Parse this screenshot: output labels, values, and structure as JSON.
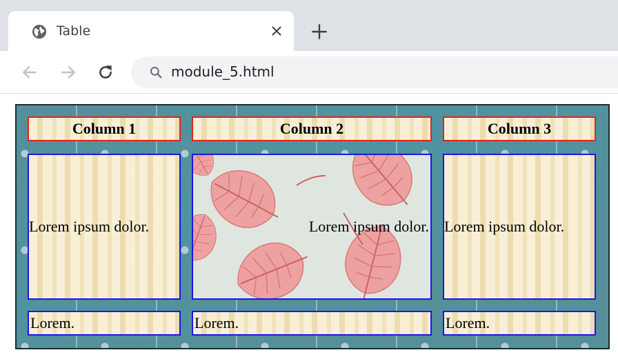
{
  "browser": {
    "tab_title": "Table",
    "url": "module_5.html",
    "icons": {
      "tab": "globe-icon",
      "close": "close-icon",
      "new_tab": "plus-icon",
      "back": "back-arrow-icon",
      "forward": "forward-arrow-icon",
      "reload": "reload-icon",
      "search": "search-icon"
    }
  },
  "table": {
    "headers": [
      "Column 1",
      "Column 2",
      "Column 3"
    ],
    "body_row": [
      "Lorem ipsum dolor.",
      "Lorem ipsum dolor.",
      "Lorem ipsum dolor."
    ],
    "footer_row": [
      "Lorem.",
      "Lorem.",
      "Lorem."
    ],
    "colors": {
      "header_border": "#e0251a",
      "cell_border": "#1717e6",
      "table_background": "#55909a",
      "cell_background": "#f3e7c4",
      "leaf_color": "#e88e8e"
    }
  }
}
